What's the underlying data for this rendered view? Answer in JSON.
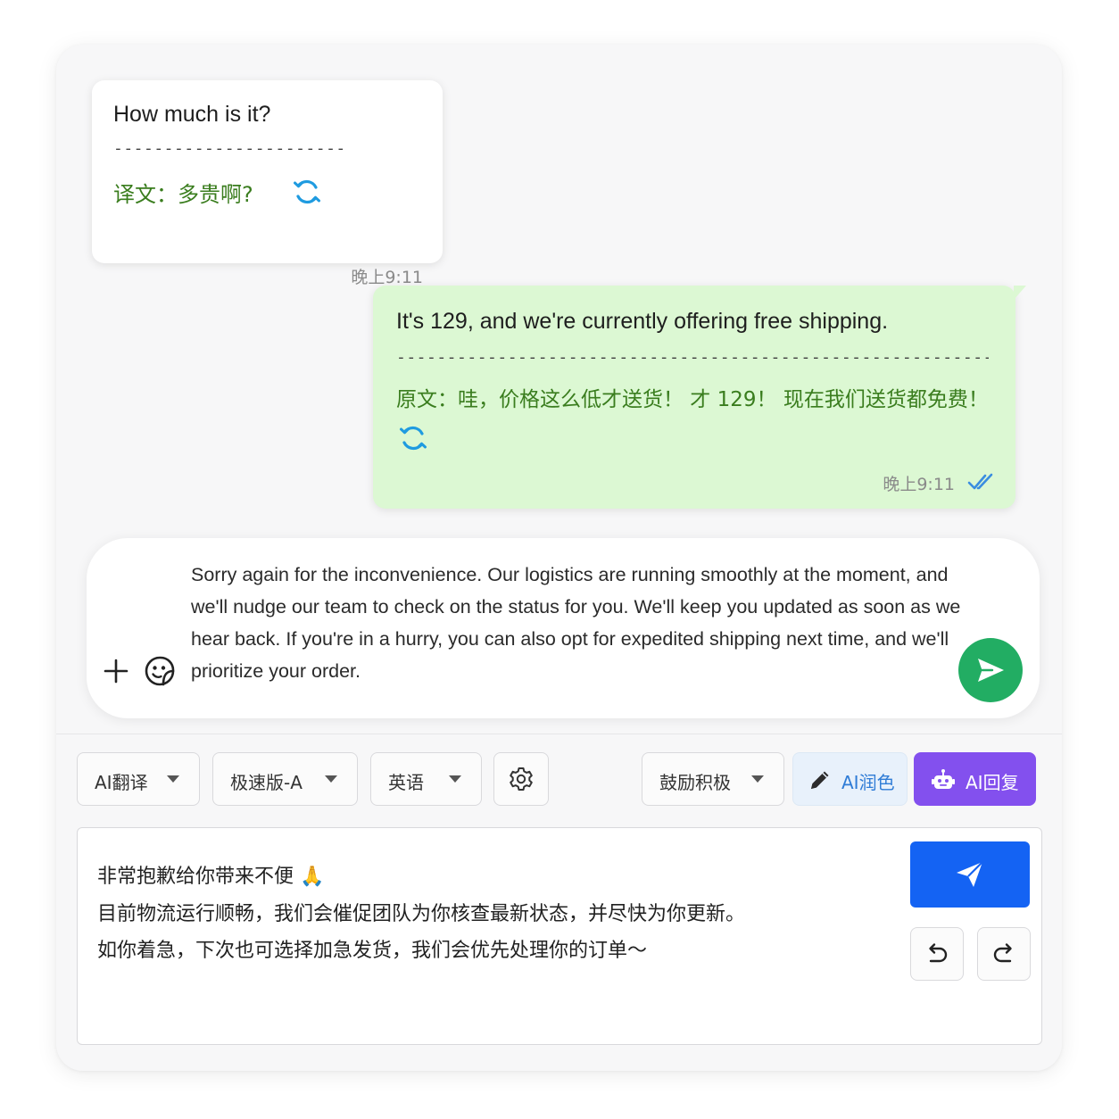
{
  "incoming": {
    "message": "How much is it?",
    "divider": "-------------------------",
    "translation": "译文：多贵啊?",
    "time": "晚上9:11"
  },
  "outgoing": {
    "message": "It's 129, and we're currently offering free shipping.",
    "divider": "----------------------------------------------------------------------------",
    "original": "原文：哇，价格这么低才送货！ 才 129！ 现在我们送货都免费！",
    "time": "晚上9:11",
    "status": "read"
  },
  "composer": {
    "draft": "Sorry again for the inconvenience. Our logistics are running smoothly at the moment, and we'll nudge our team to check on the status for you. We'll keep you updated as soon as we hear back. If you're in a hurry, you can also opt for expedited shipping next time, and we'll prioritize your order."
  },
  "toolbar": {
    "translate_label": "AI翻译",
    "mode_label": "极速版-A",
    "language_label": "英语",
    "tone_label": "鼓励积极",
    "polish_label": "AI润色",
    "reply_label": "AI回复"
  },
  "reply_box": {
    "lines": [
      "非常抱歉给你带来不便 🙏",
      "目前物流运行顺畅，我们会催促团队为你核查最新状态，并尽快为你更新。",
      "如你着急，下次也可选择加急发货，我们会优先处理你的订单～"
    ]
  },
  "colors": {
    "outgoing_bubble": "#dcf8d3",
    "translation_text": "#3a7d1e",
    "send_green": "#22ad63",
    "send_blue": "#1463f3",
    "ai_reply": "#8350ee",
    "ai_polish_text": "#2f7cd6",
    "refresh_icon": "#1f9be0"
  }
}
